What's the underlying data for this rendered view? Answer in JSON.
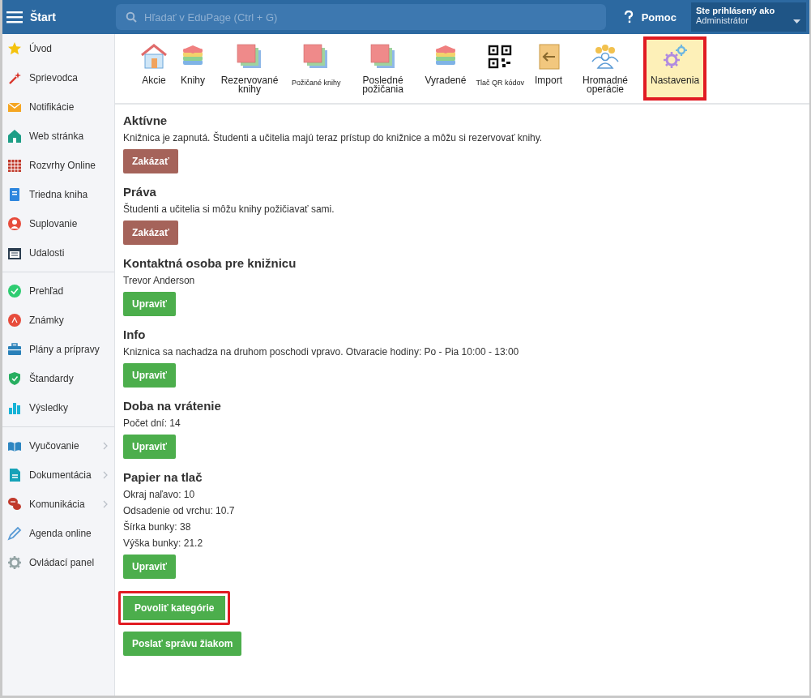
{
  "topbar": {
    "title": "Štart",
    "search": {
      "placeholder": "Hľadať v EduPage (Ctrl + G)"
    },
    "help": "Pomoc",
    "user": {
      "label": "Ste prihlásený ako",
      "name": "Administrátor"
    }
  },
  "sidebar": {
    "groups": [
      [
        {
          "label": "Úvod",
          "submenu": false
        },
        {
          "label": "Sprievodca",
          "submenu": false
        },
        {
          "label": "Notifikácie",
          "submenu": false
        },
        {
          "label": "Web stránka",
          "submenu": false
        },
        {
          "label": "Rozvrhy Online",
          "submenu": false
        },
        {
          "label": "Triedna kniha",
          "submenu": false
        },
        {
          "label": "Suplovanie",
          "submenu": false
        },
        {
          "label": "Udalosti",
          "submenu": false
        }
      ],
      [
        {
          "label": "Prehľad",
          "submenu": false
        },
        {
          "label": "Známky",
          "submenu": false
        },
        {
          "label": "Plány a prípravy",
          "submenu": false
        },
        {
          "label": "Štandardy",
          "submenu": false
        },
        {
          "label": "Výsledky",
          "submenu": false
        }
      ],
      [
        {
          "label": "Vyučovanie",
          "submenu": true
        },
        {
          "label": "Dokumentácia",
          "submenu": true
        },
        {
          "label": "Komunikácia",
          "submenu": true
        },
        {
          "label": "Agenda online",
          "submenu": false
        },
        {
          "label": "Ovládací panel",
          "submenu": false
        }
      ]
    ]
  },
  "toolbar": [
    {
      "label": "Akcie",
      "kind": "normal",
      "selected": false,
      "highlighted": false
    },
    {
      "label": "Knihy",
      "kind": "normal",
      "selected": false,
      "highlighted": false
    },
    {
      "label": "Rezervované knihy",
      "kind": "normal",
      "selected": false,
      "highlighted": false
    },
    {
      "label": "Požičané knihy",
      "kind": "small",
      "selected": false,
      "highlighted": false
    },
    {
      "label": "Posledné požičania",
      "kind": "normal",
      "selected": false,
      "highlighted": false
    },
    {
      "label": "Vyradené",
      "kind": "normal",
      "selected": false,
      "highlighted": false
    },
    {
      "label": "Tlač QR kódov",
      "kind": "small",
      "selected": false,
      "highlighted": false
    },
    {
      "label": "Import",
      "kind": "normal",
      "selected": false,
      "highlighted": false
    },
    {
      "label": "Hromadné operácie",
      "kind": "normal",
      "selected": false,
      "highlighted": false
    },
    {
      "label": "Nastavenia",
      "kind": "normal",
      "selected": true,
      "highlighted": true
    }
  ],
  "sections": [
    {
      "title": "Aktívne",
      "lines": [
        "Knižnica je zapnutá. Študenti a učitelia majú teraz prístup do knižnice a môžu si rezervovať knihy."
      ],
      "button": {
        "label": "Zakázať",
        "kind": "danger"
      }
    },
    {
      "title": "Práva",
      "lines": [
        "Študenti a učitelia si môžu knihy požičiavať sami."
      ],
      "button": {
        "label": "Zakázať",
        "kind": "danger"
      }
    },
    {
      "title": "Kontaktná osoba pre knižnicu",
      "lines": [
        "Trevor Anderson"
      ],
      "button": {
        "label": "Upraviť",
        "kind": "success"
      }
    },
    {
      "title": "Info",
      "lines": [
        "Kniznica sa nachadza na druhom poschodi vpravo. Otvaracie hodiny: Po - Pia 10:00 - 13:00"
      ],
      "button": {
        "label": "Upraviť",
        "kind": "success"
      }
    },
    {
      "title": "Doba na vrátenie",
      "lines": [
        "Počet dní: 14"
      ],
      "button": {
        "label": "Upraviť",
        "kind": "success"
      }
    },
    {
      "title": "Papier na tlač",
      "lines": [
        "Okraj naľavo: 10",
        "Odsadenie od vrchu: 10.7",
        "Šírka bunky: 38",
        "Výška bunky: 21.2"
      ],
      "button": {
        "label": "Upraviť",
        "kind": "success"
      }
    }
  ],
  "actions": [
    {
      "label": "Povoliť kategórie",
      "highlighted": true
    },
    {
      "label": "Poslať správu žiakom",
      "highlighted": false
    }
  ]
}
